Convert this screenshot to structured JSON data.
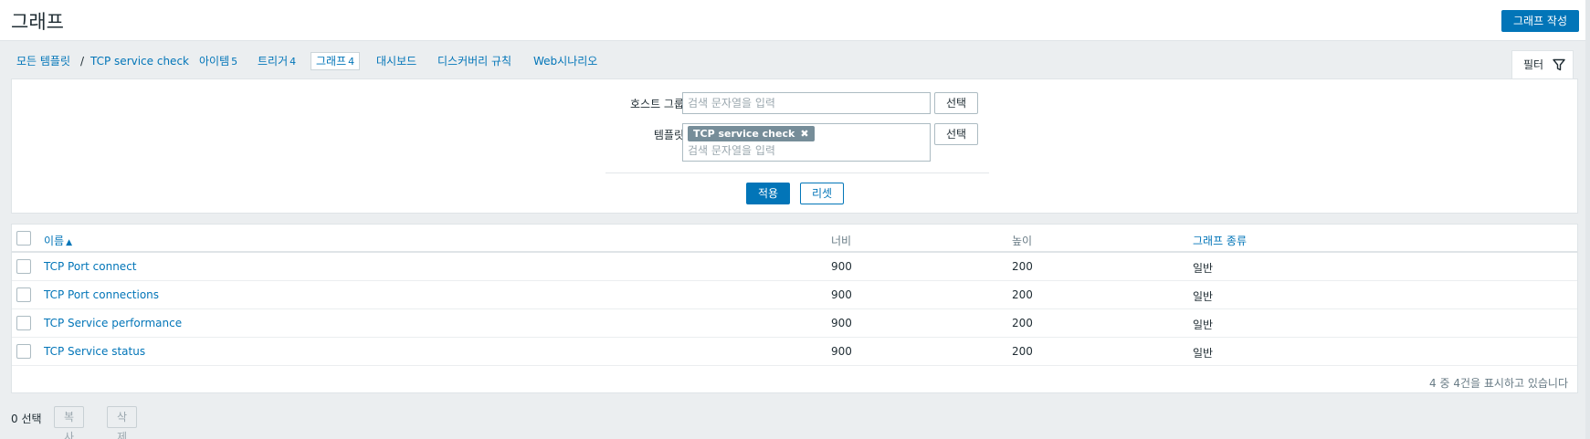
{
  "header": {
    "title": "그래프",
    "create_button": "그래프 작성"
  },
  "nav": {
    "all_templates": "모든 템플릿",
    "separator": "/",
    "template_name": "TCP service check",
    "items": [
      {
        "label": "아이템",
        "count": "5"
      },
      {
        "label": "트리거",
        "count": "4"
      },
      {
        "label": "그래프",
        "count": "4"
      },
      {
        "label": "대시보드",
        "count": ""
      },
      {
        "label": "디스커버리 규칙",
        "count": ""
      },
      {
        "label": "Web시나리오",
        "count": ""
      }
    ]
  },
  "filter": {
    "tab_label": "필터",
    "host_group_label": "호스트 그룹",
    "host_group_placeholder": "검색 문자열을 입력",
    "template_label": "템플릿",
    "template_chip": "TCP service check",
    "template_chip_remove": "✖",
    "template_placeholder": "검색 문자열을 입력",
    "select_button": "선택",
    "apply_button": "적용",
    "reset_button": "리셋"
  },
  "table": {
    "columns": {
      "name": "이름",
      "sort_indicator": "▲",
      "width": "너비",
      "height": "높이",
      "graph_type": "그래프 종류"
    },
    "rows": [
      {
        "name": "TCP Port connect",
        "width": "900",
        "height": "200",
        "type": "일반"
      },
      {
        "name": "TCP Port connections",
        "width": "900",
        "height": "200",
        "type": "일반"
      },
      {
        "name": "TCP Service performance",
        "width": "900",
        "height": "200",
        "type": "일반"
      },
      {
        "name": "TCP Service status",
        "width": "900",
        "height": "200",
        "type": "일반"
      }
    ],
    "stats": "4 중 4건을 표시하고 있습니다"
  },
  "actions": {
    "selected": "0 선택",
    "copy_button": "복사",
    "delete_button": "삭제"
  },
  "colors": {
    "accent": "#0275b8",
    "background": "#ebeef0",
    "chip": "#768d99"
  }
}
